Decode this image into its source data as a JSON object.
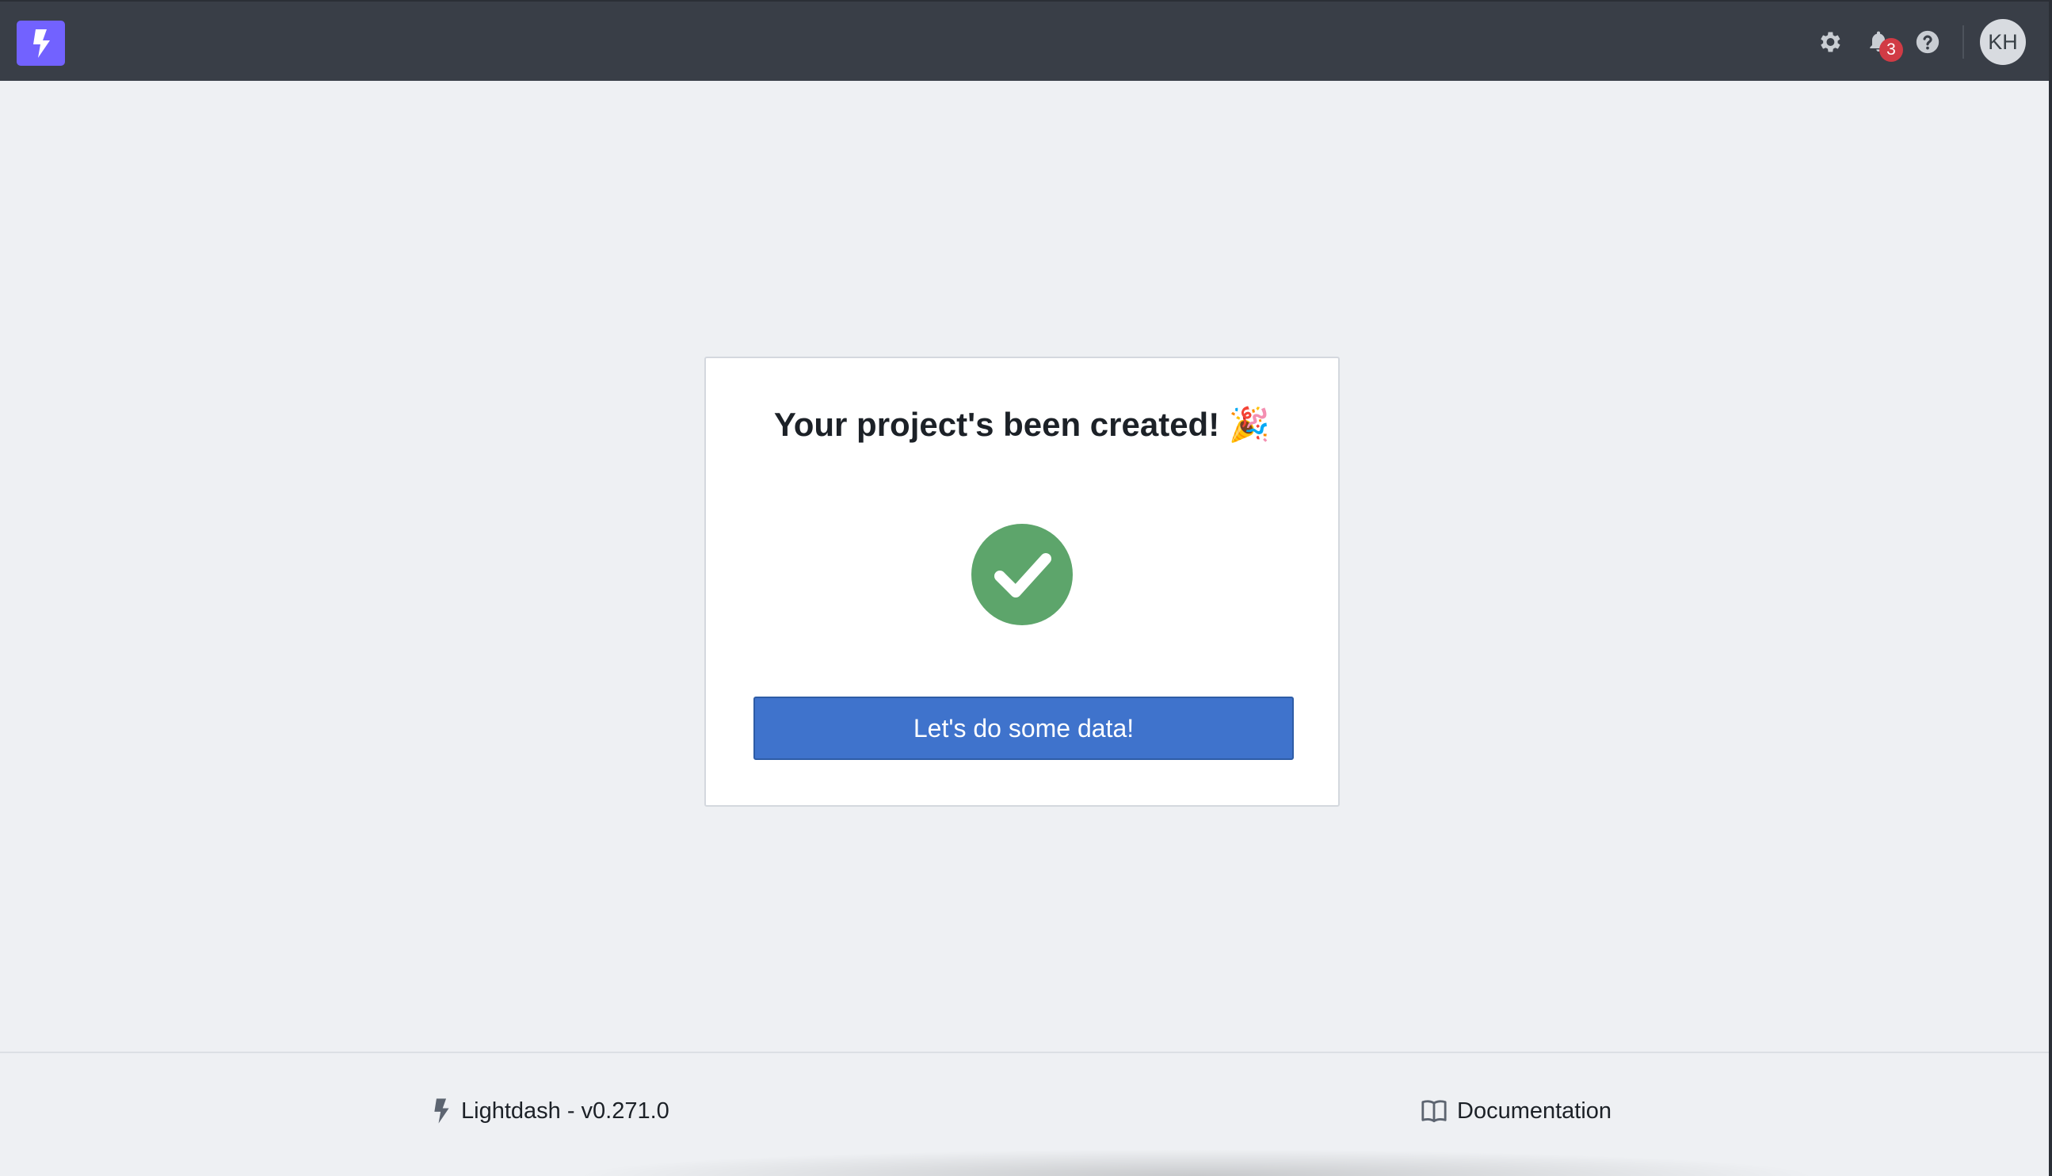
{
  "navbar": {
    "logo": "lightdash-bolt-icon",
    "settings_icon": "gear-icon",
    "notifications_icon": "bell-icon",
    "notification_count": "3",
    "help_icon": "question-circle-icon",
    "avatar_initials": "KH"
  },
  "card": {
    "title": "Your project's been created! 🎉",
    "status_icon": "check-circle-icon",
    "status_color": "#5da56b",
    "button_label": "Let's do some data!",
    "button_color": "#3f73cc"
  },
  "footer": {
    "version_label": "Lightdash - v0.271.0",
    "docs_label": "Documentation"
  },
  "colors": {
    "navbar": "#393e47",
    "logo": "#7262ff",
    "badge": "#d13b45",
    "background": "#eef0f3"
  }
}
